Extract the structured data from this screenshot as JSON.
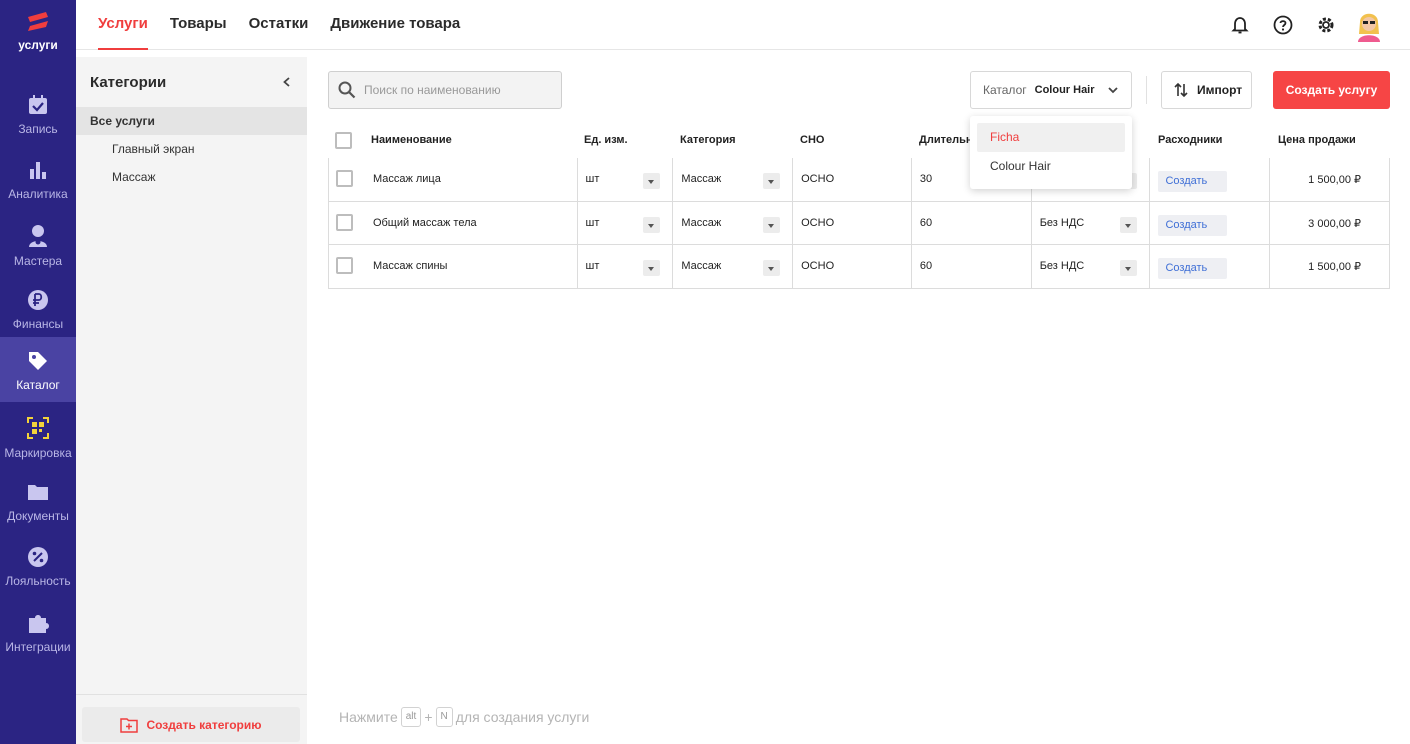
{
  "brand": {
    "label": "услуги",
    "accent": "#f03e3e"
  },
  "rail": {
    "items": [
      {
        "label": "Запись",
        "icon": "calendar-check-icon"
      },
      {
        "label": "Аналитика",
        "icon": "bar-chart-icon"
      },
      {
        "label": "Мастера",
        "icon": "master-person-icon"
      },
      {
        "label": "Финансы",
        "icon": "ruble-icon"
      },
      {
        "label": "Каталог",
        "icon": "tag-icon",
        "active": true
      },
      {
        "label": "Маркировка",
        "icon": "marking-code-icon"
      },
      {
        "label": "Документы",
        "icon": "folder-icon"
      },
      {
        "label": "Лояльность",
        "icon": "loyalty-percent-icon"
      },
      {
        "label": "Интеграции",
        "icon": "puzzle-icon"
      }
    ]
  },
  "topbar": {
    "tabs": [
      {
        "label": "Услуги",
        "active": true
      },
      {
        "label": "Товары"
      },
      {
        "label": "Остатки"
      },
      {
        "label": "Движение товара"
      }
    ]
  },
  "categories": {
    "title": "Категории",
    "items": [
      {
        "label": "Все услуги",
        "active": true
      },
      {
        "label": "Главный экран"
      },
      {
        "label": "Массаж"
      }
    ],
    "create_label": "Создать категорию"
  },
  "toolbar": {
    "search_placeholder": "Поиск по наименованию",
    "catalog_label": "Каталог",
    "catalog_value": "Colour Hair",
    "import_label": "Импорт",
    "create_label": "Создать услугу"
  },
  "catalog_dropdown": {
    "options": [
      {
        "label": "Ficha",
        "selected": true
      },
      {
        "label": "Colour Hair"
      }
    ]
  },
  "table": {
    "columns": [
      "Наименование",
      "Ед. изм.",
      "Категория",
      "СНО",
      "Длительно",
      "",
      "Расходники",
      "Цена продажи"
    ],
    "rows": [
      {
        "name": "Массаж лица",
        "unit": "шт",
        "category": "Массаж",
        "sno": "ОСНО",
        "duration": "30",
        "vat": "",
        "supplies": "Создать",
        "price": "1 500,00 ₽"
      },
      {
        "name": "Общий массаж тела",
        "unit": "шт",
        "category": "Массаж",
        "sno": "ОСНО",
        "duration": "60",
        "vat": "Без НДС",
        "supplies": "Создать",
        "price": "3 000,00 ₽"
      },
      {
        "name": "Массаж спины",
        "unit": "шт",
        "category": "Массаж",
        "sno": "ОСНО",
        "duration": "60",
        "vat": "Без НДС",
        "supplies": "Создать",
        "price": "1 500,00 ₽"
      }
    ]
  },
  "hint": {
    "before": "Нажмите",
    "key1": "alt",
    "plus": "+",
    "key2": "N",
    "after": "для создания услуги"
  }
}
